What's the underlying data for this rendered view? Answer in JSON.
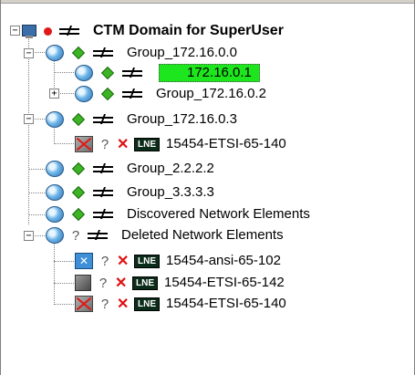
{
  "tree": {
    "root": {
      "label": "CTM Domain for SuperUser"
    },
    "group1": {
      "label": "Group_172.16.0.0"
    },
    "group1_child": {
      "label": "172.16.0.1"
    },
    "group2": {
      "label": "Group_172.16.0.2"
    },
    "group3": {
      "label": "Group_172.16.0.3"
    },
    "ne1": {
      "badge": "LNE",
      "label": "15454-ETSI-65-140",
      "status_unknown": "?"
    },
    "group4": {
      "label": "Group_2.2.2.2"
    },
    "group5": {
      "label": "Group_3.3.3.3"
    },
    "discovered": {
      "label": "Discovered Network Elements"
    },
    "deleted": {
      "label": "Deleted Network Elements",
      "status_unknown": "?"
    },
    "ne2": {
      "badge": "LNE",
      "label": "15454-ansi-65-102",
      "status_unknown": "?"
    },
    "ne3": {
      "badge": "LNE",
      "label": "15454-ETSI-65-142",
      "status_unknown": "?"
    },
    "ne4": {
      "badge": "LNE",
      "label": "15454-ETSI-65-140",
      "status_unknown": "?"
    }
  },
  "expanders": {
    "collapse": "−",
    "expand": "+"
  },
  "colors": {
    "selection": "#1ee61e",
    "status_red": "#e01818",
    "status_green": "#3cb424"
  }
}
